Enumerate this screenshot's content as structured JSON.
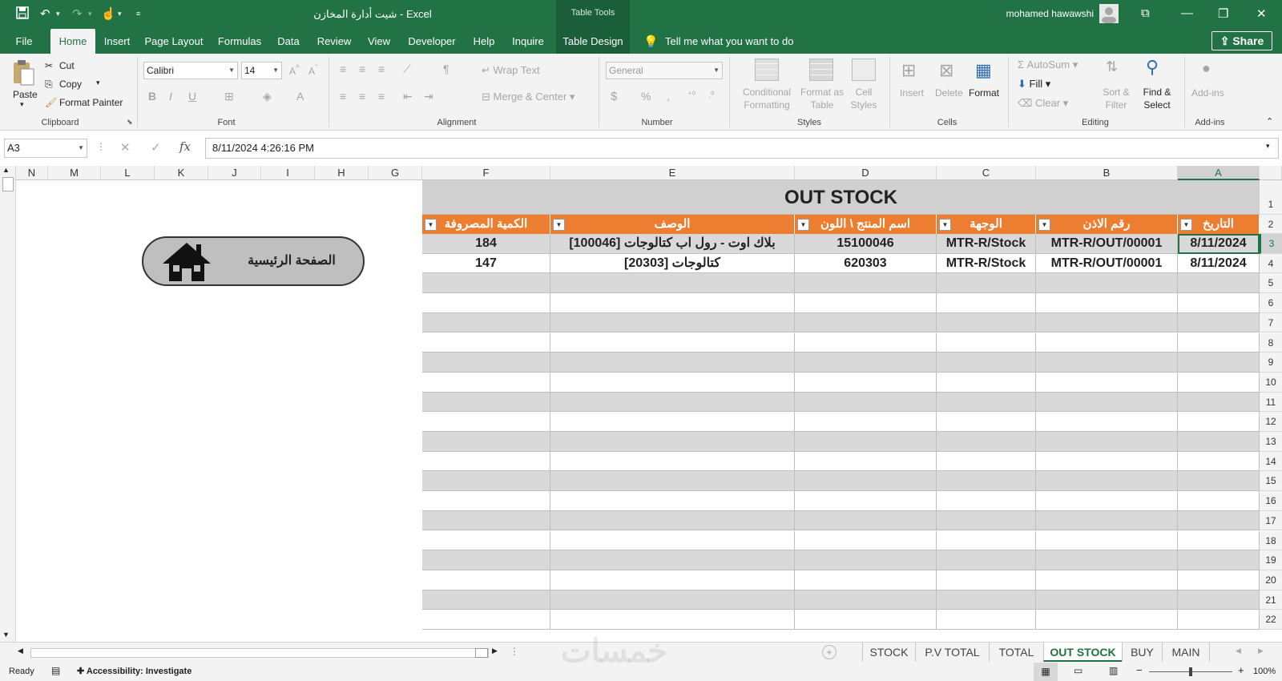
{
  "titlebar": {
    "title": "شيت أدارة المخازن  -  Excel",
    "contextual": "Table Tools",
    "user": "mohamed hawawshi",
    "icons": [
      "save-icon",
      "undo-icon",
      "redo-icon",
      "touch-mode-icon",
      "customize-qat-icon"
    ]
  },
  "tabs": [
    "File",
    "Home",
    "Insert",
    "Page Layout",
    "Formulas",
    "Data",
    "Review",
    "View",
    "Developer",
    "Help",
    "Inquire",
    "Table Design"
  ],
  "tell_me": "Tell me what you want to do",
  "share": "Share",
  "ribbon": {
    "clipboard": {
      "label": "Clipboard",
      "paste": "Paste",
      "cut": "Cut",
      "copy": "Copy",
      "format_painter": "Format Painter"
    },
    "font": {
      "label": "Font",
      "name": "Calibri",
      "size": "14"
    },
    "alignment": {
      "label": "Alignment",
      "wrap": "Wrap Text",
      "merge": "Merge & Center"
    },
    "number": {
      "label": "Number",
      "format": "General"
    },
    "styles": {
      "label": "Styles",
      "conditional": "Conditional Formatting",
      "format_table": "Format as Table",
      "cell_styles": "Cell Styles"
    },
    "cells": {
      "label": "Cells",
      "insert": "Insert",
      "delete": "Delete",
      "format": "Format"
    },
    "editing": {
      "label": "Editing",
      "autosum": "AutoSum",
      "fill": "Fill",
      "clear": "Clear",
      "sort": "Sort & Filter",
      "find": "Find & Select"
    },
    "addins": {
      "label": "Add-ins",
      "addins": "Add-ins"
    }
  },
  "formula": {
    "namebox": "A3",
    "fx": "fx",
    "content": "8/11/2024  4:26:16 PM"
  },
  "columns": [
    "N",
    "M",
    "L",
    "K",
    "J",
    "I",
    "H",
    "G",
    "F",
    "E",
    "D",
    "C",
    "B",
    "A"
  ],
  "rows": [
    "1",
    "2",
    "3",
    "4",
    "5",
    "6",
    "7",
    "8",
    "9",
    "10",
    "11",
    "12",
    "13",
    "14",
    "15",
    "16",
    "17",
    "18",
    "19",
    "20",
    "21",
    "22"
  ],
  "sheet": {
    "title": "OUT STOCK",
    "headers": {
      "A": "التاريخ",
      "B": "رقم الاذن",
      "C": "الوجهة",
      "D": "اسم المنتج \\ اللون",
      "E": "الوصف",
      "F": "الكمية المصروفة"
    },
    "data": [
      {
        "A": "8/11/2024",
        "B": "MTR-R/OUT/00001",
        "C": "MTR-R/Stock",
        "D": "15100046",
        "E": "بلاك اوت - رول اب كتالوجات [100046]",
        "F": "184"
      },
      {
        "A": "8/11/2024",
        "B": "MTR-R/OUT/00001",
        "C": "MTR-R/Stock",
        "D": "620303",
        "E": "كتالوجات [20303]",
        "F": "147"
      }
    ],
    "home_button": "الصفحة الرئيسية"
  },
  "sheet_tabs": [
    "STOCK",
    "P.V TOTAL",
    "TOTAL",
    "OUT STOCK",
    "BUY",
    "MAIN"
  ],
  "active_sheet": "OUT STOCK",
  "watermark": "خمسات",
  "status": {
    "ready": "Ready",
    "accessibility": "Accessibility: Investigate",
    "zoom": "100%"
  },
  "colors": {
    "excel_green": "#217346",
    "header_orange": "#ed7d31",
    "band_gray": "#d9d9d9",
    "title_gray": "#d0d0d0"
  }
}
